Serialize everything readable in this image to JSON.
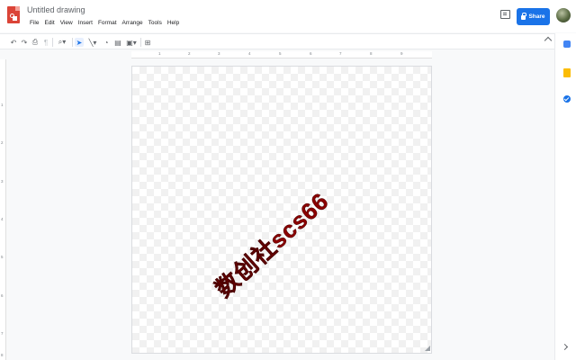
{
  "document": {
    "title": "Untitled drawing"
  },
  "menu": [
    "File",
    "Edit",
    "View",
    "Insert",
    "Format",
    "Arrange",
    "Tools",
    "Help"
  ],
  "header": {
    "share_label": "Share"
  },
  "toolbar": {
    "tools": [
      "undo-icon",
      "redo-icon",
      "print-icon",
      "paint-format-icon",
      "zoom-icon",
      "select-icon",
      "line-icon",
      "shape-icon",
      "textbox-icon",
      "image-icon",
      "add-comment-icon"
    ]
  },
  "ruler": {
    "top_numbers": [
      "1",
      "2",
      "3",
      "4",
      "5",
      "6",
      "7",
      "8",
      "9"
    ],
    "left_numbers": [
      "1",
      "2",
      "3",
      "4",
      "5",
      "6",
      "7",
      "8"
    ]
  },
  "canvas": {
    "watermark_text": "数创社scs66",
    "watermark_color": "#8b0000"
  },
  "side_panel": {
    "icons": [
      "calendar-icon",
      "keep-icon",
      "tasks-icon"
    ]
  }
}
